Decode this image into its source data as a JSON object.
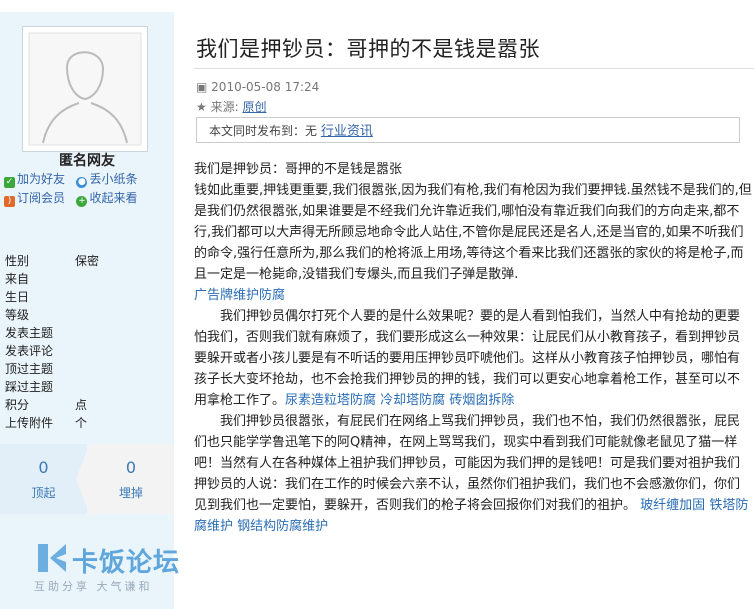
{
  "user": {
    "name": "匿名网友",
    "actions": [
      {
        "label": "加为好友",
        "icon": "add-friend-icon",
        "color": "#3aa83a"
      },
      {
        "label": "丢小纸条",
        "icon": "note-icon",
        "color": "#3a8fd8"
      },
      {
        "label": "订阅会员",
        "icon": "rss-icon",
        "color": "#e06a2a"
      },
      {
        "label": "收起来看",
        "icon": "collect-icon",
        "color": "#3aa83a"
      }
    ],
    "info": [
      {
        "key": "性别",
        "value": "保密"
      },
      {
        "key": "来自",
        "value": ""
      },
      {
        "key": "生日",
        "value": ""
      },
      {
        "key": "等级",
        "value": ""
      },
      {
        "key": "发表主题",
        "value": ""
      },
      {
        "key": "发表评论",
        "value": ""
      },
      {
        "key": "顶过主题",
        "value": ""
      },
      {
        "key": "踩过主题",
        "value": ""
      },
      {
        "key": "积分",
        "value": "点"
      },
      {
        "key": "上传附件",
        "value": "个"
      }
    ]
  },
  "votes": {
    "up_count": "0",
    "up_label": "顶起",
    "down_count": "0",
    "down_label": "埋掉"
  },
  "article": {
    "title": "我们是押钞员：哥押的不是钱是嚣张",
    "date": "2010-05-08 17:24",
    "source_label": "来源:",
    "source_link": "原创",
    "sync_label": "本文同时发布到：无",
    "sync_link": "行业资讯",
    "p1": "我们是押钞员：哥押的不是钱是嚣张",
    "p2": "钱如此重要,押钱更重要,我们很嚣张,因为我们有枪,我们有枪因为我们要押钱.虽然钱不是我们的,但是我们仍然很嚣张,如果谁要是不经我们允许靠近我们,哪怕没有靠近我们向我们的方向走来,都不行,我们都可以大声得无所顾忌地命令此人站住,不管你是屁民还是名人,还是当官的,如果不听我们的命令,强行任意所为,那么我们的枪将派上用场,等待这个看来比我们还嚣张的家伙的将是枪子,而且一定是一枪毙命,没错我们专爆头,而且我们子弹是散弹.",
    "link1": "广告牌维护防腐",
    "p3": "我们押钞员偶尔打死个人要的是什么效果呢？要的是人看到怕我们，当然人中有抢劫的更要怕我们，否则我们就有麻烦了，我们要形成这么一种效果：让屁民们从小教育孩子，看到押钞员要躲开或者小孩儿要是有不听话的要用压押钞员吓唬他们。这样从小教育孩子怕押钞员，哪怕有孩子长大变坏抢劫，也不会抢我们押钞员的押的钱，我们可以更安心地拿着枪工作，甚至可以不用拿枪工作了。",
    "link2": "尿素造粒塔防腐",
    "link3": "冷却塔防腐",
    "link4": "砖烟囱拆除",
    "p4": "我们押钞员很嚣张，有屁民们在网络上骂我们押钞员，我们也不怕，我们仍然很嚣张，屁民们也只能学学鲁迅笔下的阿Q精神，在网上骂骂我们，现实中看到我们可能就像老鼠见了猫一样吧！当然有人在各种媒体上祖护我们押钞员，可能因为我们押的是钱吧！可是我们要对祖护我们押钞员的人说：我们在工作的时候会六亲不认，虽然你们祖护我们，我们也不会感激你们，你们见到我们也一定要怕，要躲开，否则我们的枪子将会回报你们对我们的祖护。",
    "link5": "玻纤缠加固",
    "link6": "铁塔防腐维护",
    "link7": "钢结构防腐维护"
  },
  "watermark": {
    "logo_text": "卡饭论坛",
    "slogan": "互助分享  大气谦和"
  }
}
